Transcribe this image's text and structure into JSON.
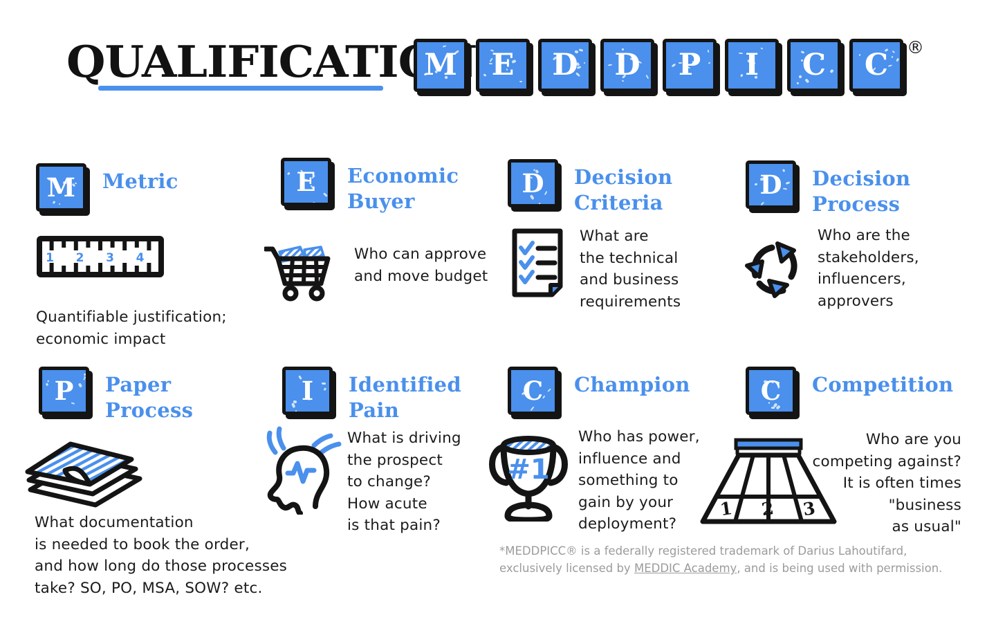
{
  "header": {
    "title": "QUALIFICATION",
    "registered_mark": "®",
    "accent_color": "#4a90ec",
    "ink_color": "#141414",
    "tiles": [
      {
        "letter": "M"
      },
      {
        "letter": "E"
      },
      {
        "letter": "D"
      },
      {
        "letter": "D"
      },
      {
        "letter": "P"
      },
      {
        "letter": "I"
      },
      {
        "letter": "C"
      },
      {
        "letter": "C"
      }
    ]
  },
  "cards": [
    {
      "letter": "M",
      "title": "Metric",
      "body": "Quantifiable justification;\neconomic impact",
      "icon": "ruler-icon",
      "ruler_marks": [
        "1",
        "2",
        "3",
        "4"
      ]
    },
    {
      "letter": "E",
      "title": "Economic\nBuyer",
      "body": "Who can approve\nand move budget",
      "icon": "shopping-cart-icon"
    },
    {
      "letter": "D",
      "title": "Decision\nCriteria",
      "body": "What are\nthe technical\nand business\nrequirements",
      "icon": "checklist-document-icon"
    },
    {
      "letter": "D",
      "title": "Decision\nProcess",
      "body": "Who are the\nstakeholders,\ninfluencers,\napprovers",
      "icon": "cycle-arrows-icon"
    },
    {
      "letter": "P",
      "title": "Paper\nProcess",
      "body": "What documentation\nis needed to book the order,\nand how long do those processes\ntake? SO, PO, MSA, SOW? etc.",
      "icon": "paper-stack-icon"
    },
    {
      "letter": "I",
      "title": "Identified\nPain",
      "body": "What is driving\nthe prospect\nto change?\nHow acute\nis that pain?",
      "icon": "head-pulse-icon"
    },
    {
      "letter": "C",
      "title": "Champion",
      "body": "Who has power,\ninfluence and\nsomething to\ngain by your\ndeployment?",
      "icon": "trophy-icon",
      "trophy_label": "#1"
    },
    {
      "letter": "C",
      "title": "Competition",
      "body": "Who are you\ncompeting against?\nIt is often times\n\"business\nas usual\"",
      "icon": "running-track-icon",
      "lane_numbers": [
        "1",
        "2",
        "3"
      ]
    }
  ],
  "footer": {
    "text_before": "*MEDDPICC® is a federally registered trademark of Darius Lahoutifard, exclusively licensed by ",
    "link_label": "MEDDIC Academy",
    "text_after": ", and is being used with permission."
  }
}
